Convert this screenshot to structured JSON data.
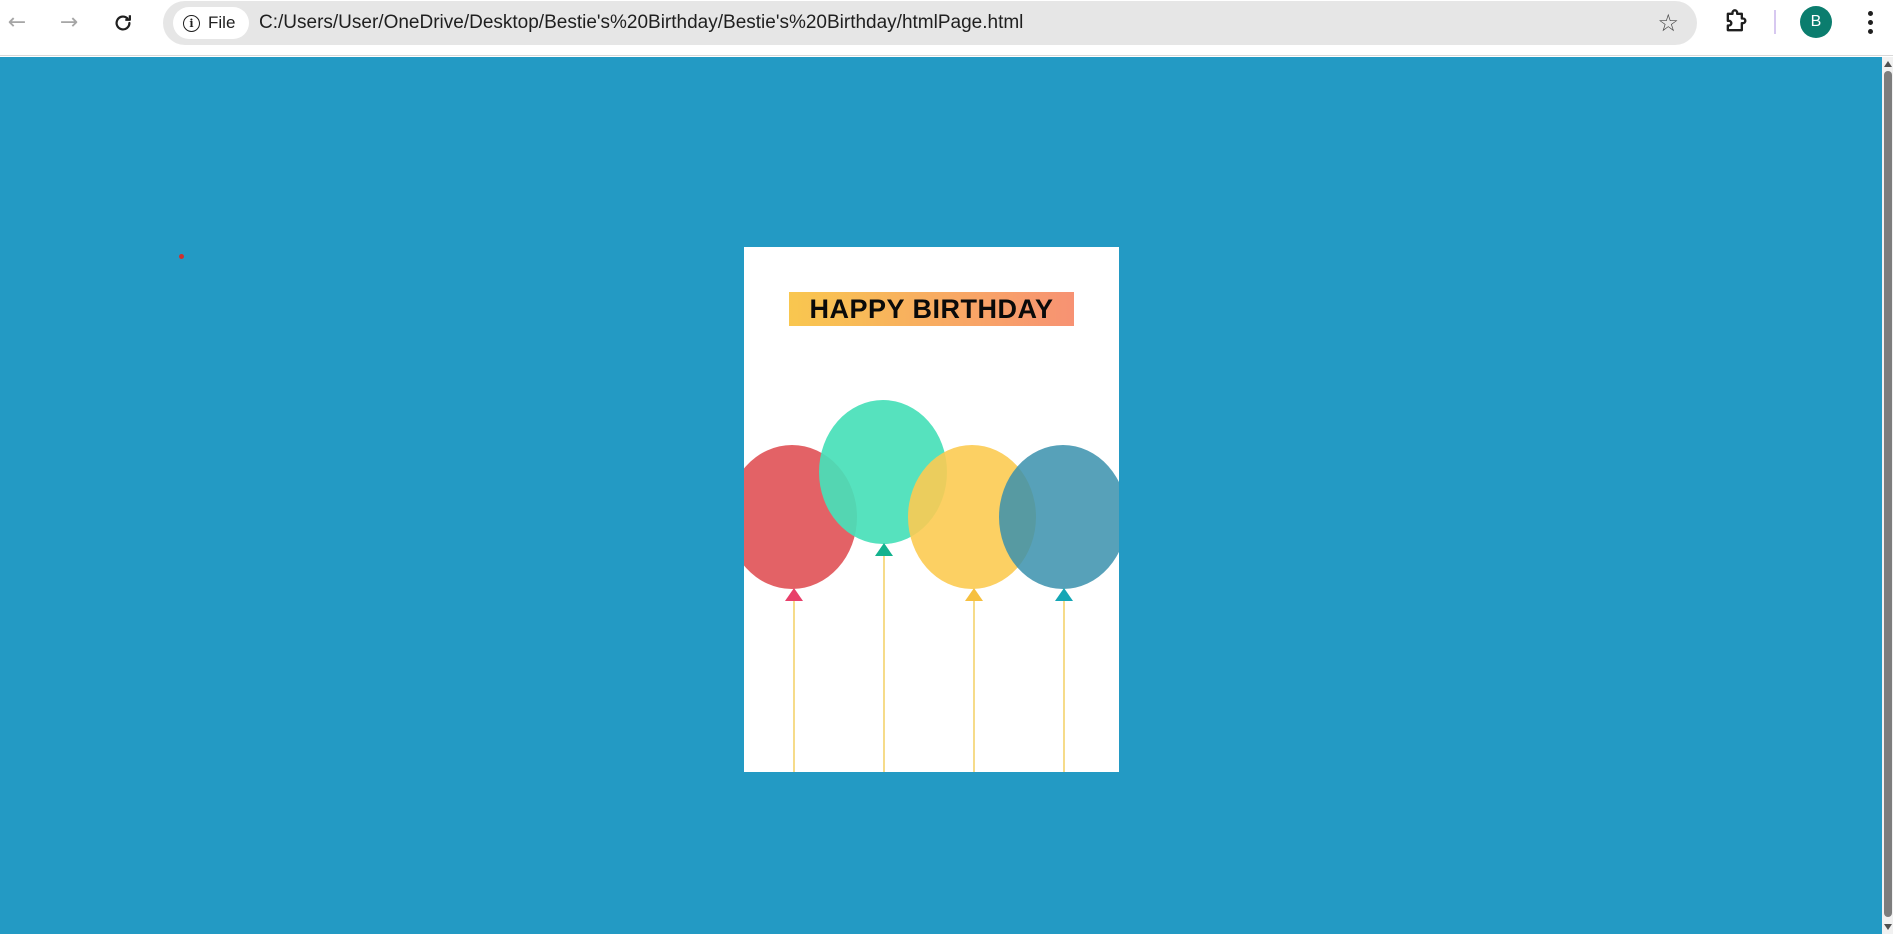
{
  "browser": {
    "site_chip_label": "File",
    "url": "C:/Users/User/OneDrive/Desktop/Bestie's%20Birthday/Bestie's%20Birthday/htmlPage.html",
    "profile_initial": "B",
    "profile_color": "#0b7d6e"
  },
  "page": {
    "background_color": "#239ac4",
    "card": {
      "title": "HAPPY BIRTHDAY",
      "banner_gradient": [
        "#f9c74f",
        "#f79273"
      ],
      "balloons": [
        {
          "name": "red-balloon",
          "color": "#e15a5e",
          "knot_color": "#e8406a",
          "string_color": "#f2c84b"
        },
        {
          "name": "mint-balloon",
          "color": "#48e0b9",
          "knot_color": "#13b28e",
          "string_color": "#f2c84b"
        },
        {
          "name": "yellow-balloon",
          "color": "#fccb52",
          "knot_color": "#f6c040",
          "string_color": "#f2c84b"
        },
        {
          "name": "teal-balloon",
          "color": "#3a91ad",
          "knot_color": "#15a6b5",
          "string_color": "#f2c84b"
        }
      ]
    }
  },
  "icons": {
    "back": "arrow-left-icon",
    "forward": "arrow-right-icon",
    "reload": "reload-icon",
    "info": "info-icon",
    "bookmark": "star-icon",
    "extensions": "puzzle-icon",
    "menu": "kebab-menu-icon"
  }
}
